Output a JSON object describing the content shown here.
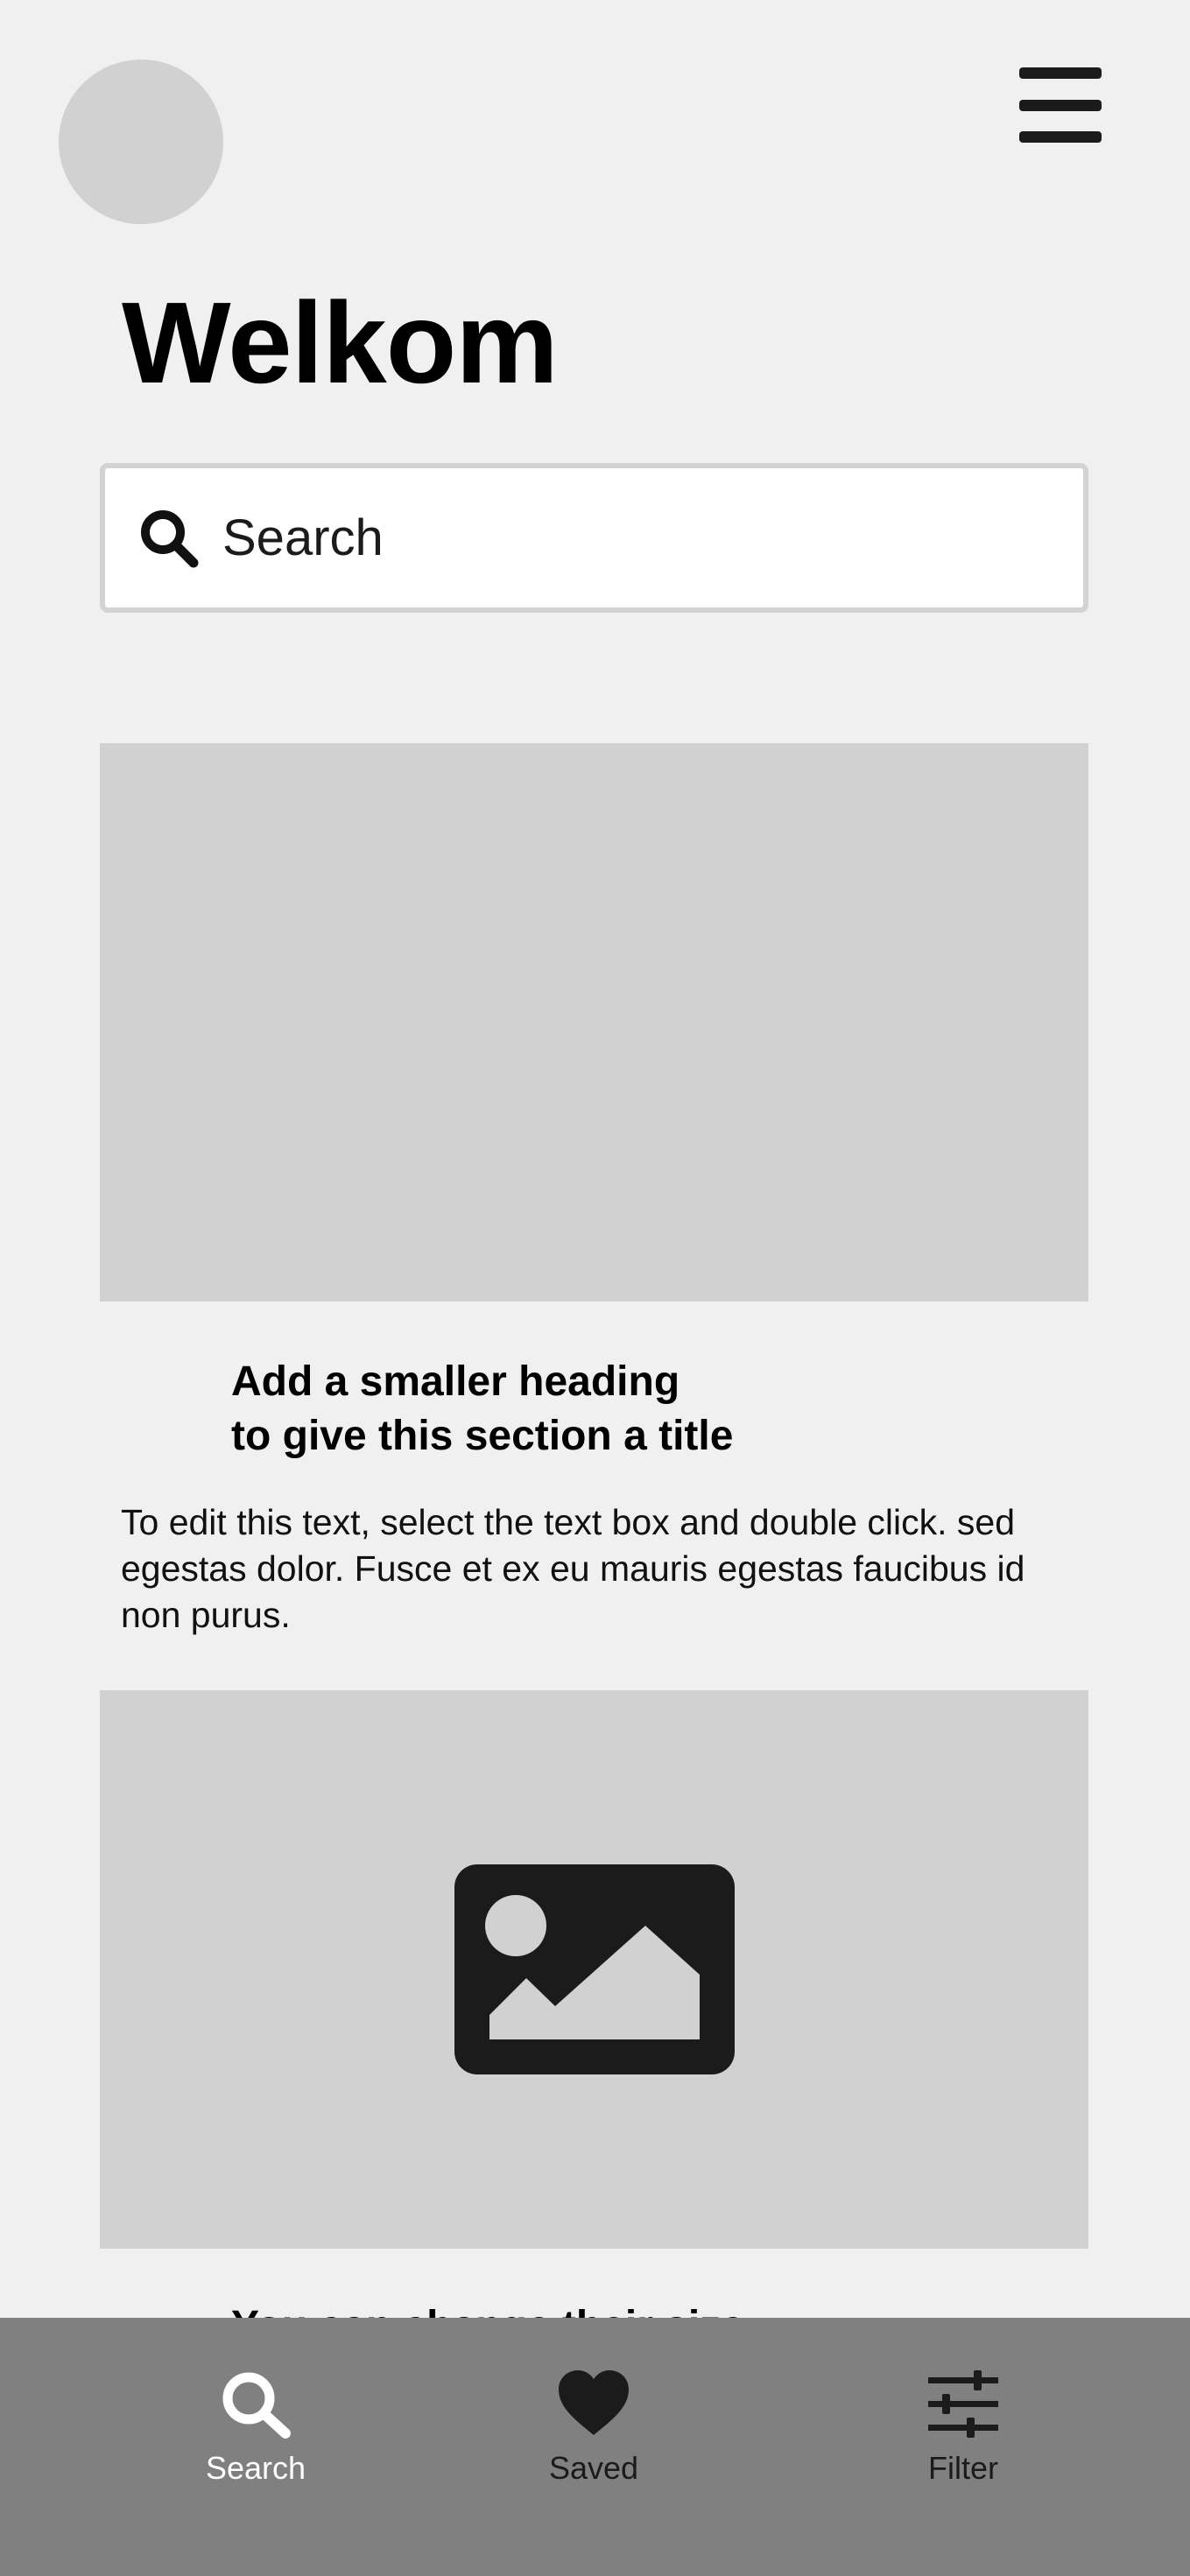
{
  "header": {
    "title": "Welkom"
  },
  "search": {
    "placeholder": "Search"
  },
  "sections": [
    {
      "heading_line1": "Add a smaller heading",
      "heading_line2": "to give this section a title",
      "body": "To edit this text, select the text box and double click. sed egestas dolor. Fusce et ex eu mauris egestas faucibus id non purus."
    },
    {
      "heading_line1": "You can change their size"
    }
  ],
  "bottom_nav": {
    "items": [
      {
        "label": "Search",
        "icon": "search-icon",
        "active": true
      },
      {
        "label": "Saved",
        "icon": "heart-icon",
        "active": false
      },
      {
        "label": "Filter",
        "icon": "sliders-icon",
        "active": false
      }
    ]
  },
  "colors": {
    "background": "#f1f0f1",
    "placeholder": "#d1d1d1",
    "nav_background": "#808080",
    "icon_dark": "#1b1b1b",
    "active_nav": "#ffffff"
  }
}
